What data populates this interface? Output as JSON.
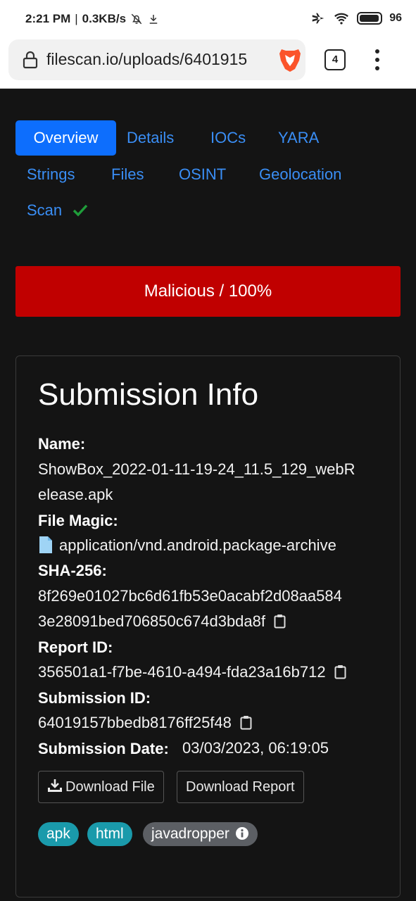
{
  "status_bar": {
    "time": "2:21 PM",
    "net_speed": "0.3KB/s",
    "battery": "96",
    "battery_level": 0.96
  },
  "browser": {
    "url": "filescan.io/uploads/6401915",
    "tab_count": "4"
  },
  "tabs": [
    {
      "label": "Overview",
      "active": true
    },
    {
      "label": "Details"
    },
    {
      "label": "IOCs"
    },
    {
      "label": "YARA"
    },
    {
      "label": "Strings"
    },
    {
      "label": "Files"
    },
    {
      "label": "OSINT"
    },
    {
      "label": "Geolocation"
    },
    {
      "label": "Scan"
    }
  ],
  "verdict": {
    "text": "Malicious / 100%",
    "color": "#c00000"
  },
  "submission": {
    "title": "Submission Info",
    "name_label": "Name:",
    "name_line1": "ShowBox_2022-01-11-19-24_11.5_129_webR",
    "name_line2": "elease.apk",
    "magic_label": "File Magic:",
    "magic_value": "application/vnd.android.package-archive",
    "sha_label": "SHA-256:",
    "sha_line1": "8f269e01027bc6d61fb53e0acabf2d08aa584",
    "sha_line2": "3e28091bed706850c674d3bda8f",
    "report_label": "Report ID:",
    "report_value": "356501a1-f7be-4610-a494-fda23a16b712",
    "subid_label": "Submission ID:",
    "subid_value": "64019157bbedb8176ff25f48",
    "date_label": "Submission Date:",
    "date_value": "03/03/2023, 06:19:05"
  },
  "buttons": {
    "download_file": "Download File",
    "download_report": "Download Report"
  },
  "tags": [
    "apk",
    "html",
    "javadropper"
  ],
  "colors": {
    "accent": "#0d6efd",
    "link": "#3a8ef5",
    "tag_teal": "#1a9aab",
    "tag_gray": "#5c5f64",
    "check": "#1f9d3a"
  }
}
